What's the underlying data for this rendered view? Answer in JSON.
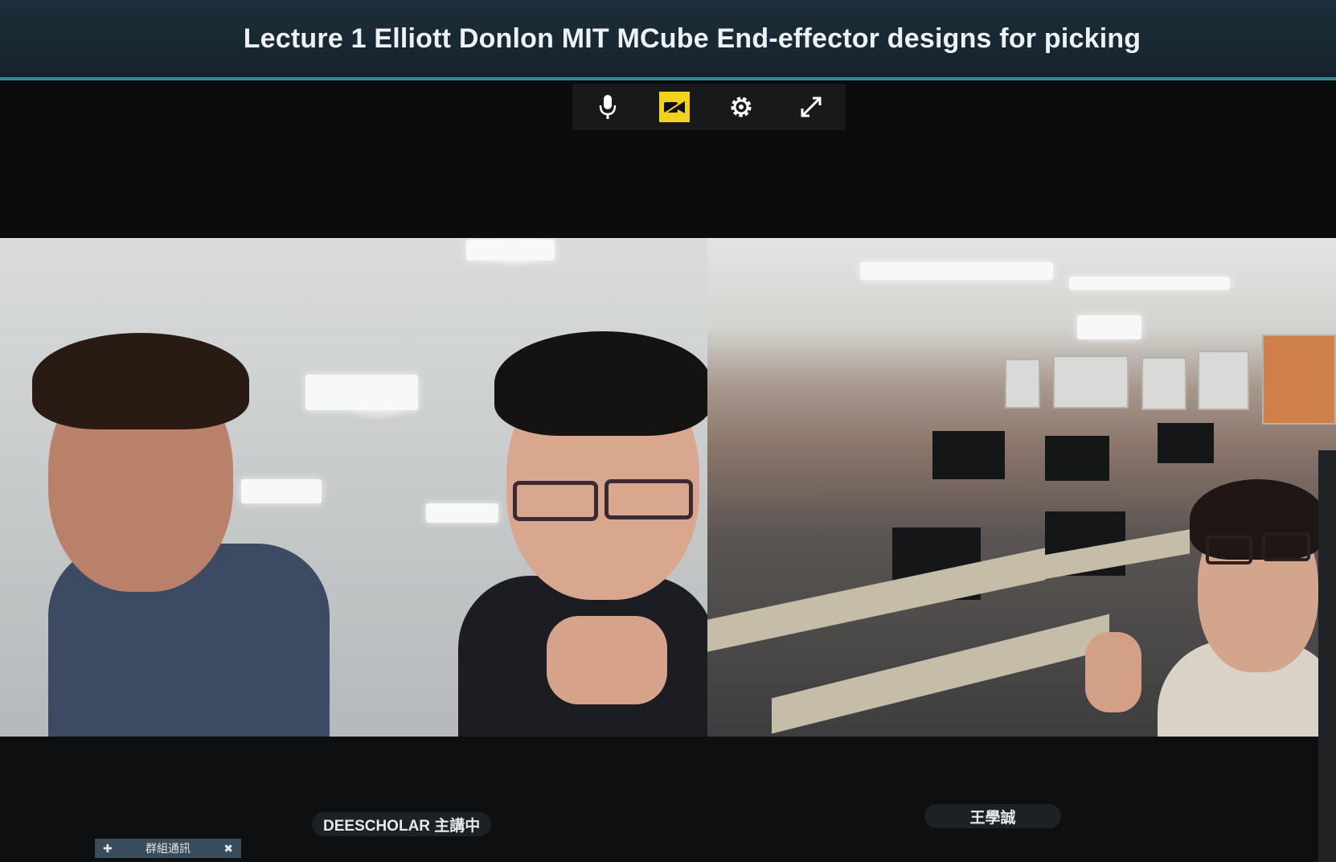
{
  "window": {
    "title": "Lecture 1 Elliott Donlon MIT MCube End-effector designs for picking"
  },
  "toolbar": {
    "buttons": [
      {
        "icon": "microphone-icon",
        "active": false
      },
      {
        "icon": "camera-icon",
        "active": true
      },
      {
        "icon": "settings-gear-icon",
        "active": false
      },
      {
        "icon": "fullscreen-icon",
        "active": false
      }
    ],
    "active_color": "#f2d21b"
  },
  "participants": [
    {
      "name_label": "DEESCHOLAR 主講中"
    },
    {
      "name_label": "王學誠"
    }
  ],
  "mini_panel": {
    "label": "群組通訊"
  },
  "colors": {
    "title_bar": "#1d2e3a",
    "title_accent": "#2f8f98",
    "background": "#0a0c0d"
  }
}
